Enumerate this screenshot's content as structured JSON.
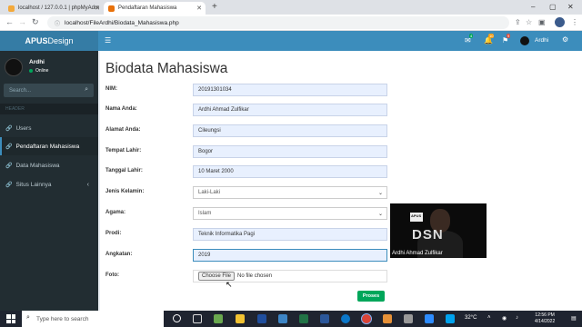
{
  "browser": {
    "tabs": [
      {
        "title": "localhost / 127.0.0.1 | phpMyAdm"
      },
      {
        "title": "Pendaftaran Mahasiswa"
      }
    ],
    "address": "localhost/FileArdhi/Biodata_Mahasiswa.php"
  },
  "app": {
    "brand_bold": "APUS",
    "brand_light": "Design",
    "topnav_user": "Ardhi",
    "badges": {
      "messages": "4",
      "notifications": "10",
      "tasks": "9"
    }
  },
  "sidebar": {
    "user_name": "Ardhi",
    "user_status": "Online",
    "search_placeholder": "Search...",
    "section_header": "HEADER",
    "items": [
      {
        "label": "Users"
      },
      {
        "label": "Pendaftaran Mahasiswa"
      },
      {
        "label": "Data Mahasiswa"
      },
      {
        "label": "Situs Lainnya"
      }
    ]
  },
  "form": {
    "title": "Biodata Mahasiswa",
    "fields": {
      "nim": {
        "label": "NIM:",
        "value": "20191301034"
      },
      "nama": {
        "label": "Nama Anda:",
        "value": "Ardhi Ahmad Zulfikar"
      },
      "alamat": {
        "label": "Alamat Anda:",
        "value": "Cileungsi"
      },
      "tempat_lahir": {
        "label": "Tempat Lahir:",
        "value": "Bogor"
      },
      "tanggal_lahir": {
        "label": "Tanggal Lahir:",
        "value": "10 Maret 2000"
      },
      "jenis_kelamin": {
        "label": "Jenis Kelamin:",
        "value": "Laki-Laki"
      },
      "agama": {
        "label": "Agama:",
        "value": "Islam"
      },
      "prodi": {
        "label": "Prodi:",
        "value": "Teknik Informatika Pagi"
      },
      "angkatan": {
        "label": "Angkatan:",
        "value": "2019"
      },
      "foto": {
        "label": "Foto:",
        "button": "Choose File",
        "status": "No file chosen"
      }
    },
    "submit_label": "Proses"
  },
  "video_overlay": {
    "name": "Ardhi Ahmad Zulfikar",
    "badge_text": "APUS",
    "big_text": "DSN"
  },
  "taskbar": {
    "search_placeholder": "Type here to search",
    "temperature": "32°C",
    "time": "12:56 PM",
    "date": "4/14/2022"
  },
  "colors": {
    "header": "#3c8dbc",
    "brand": "#357ca5",
    "sidebar": "#222d32",
    "submit": "#00a65a"
  }
}
